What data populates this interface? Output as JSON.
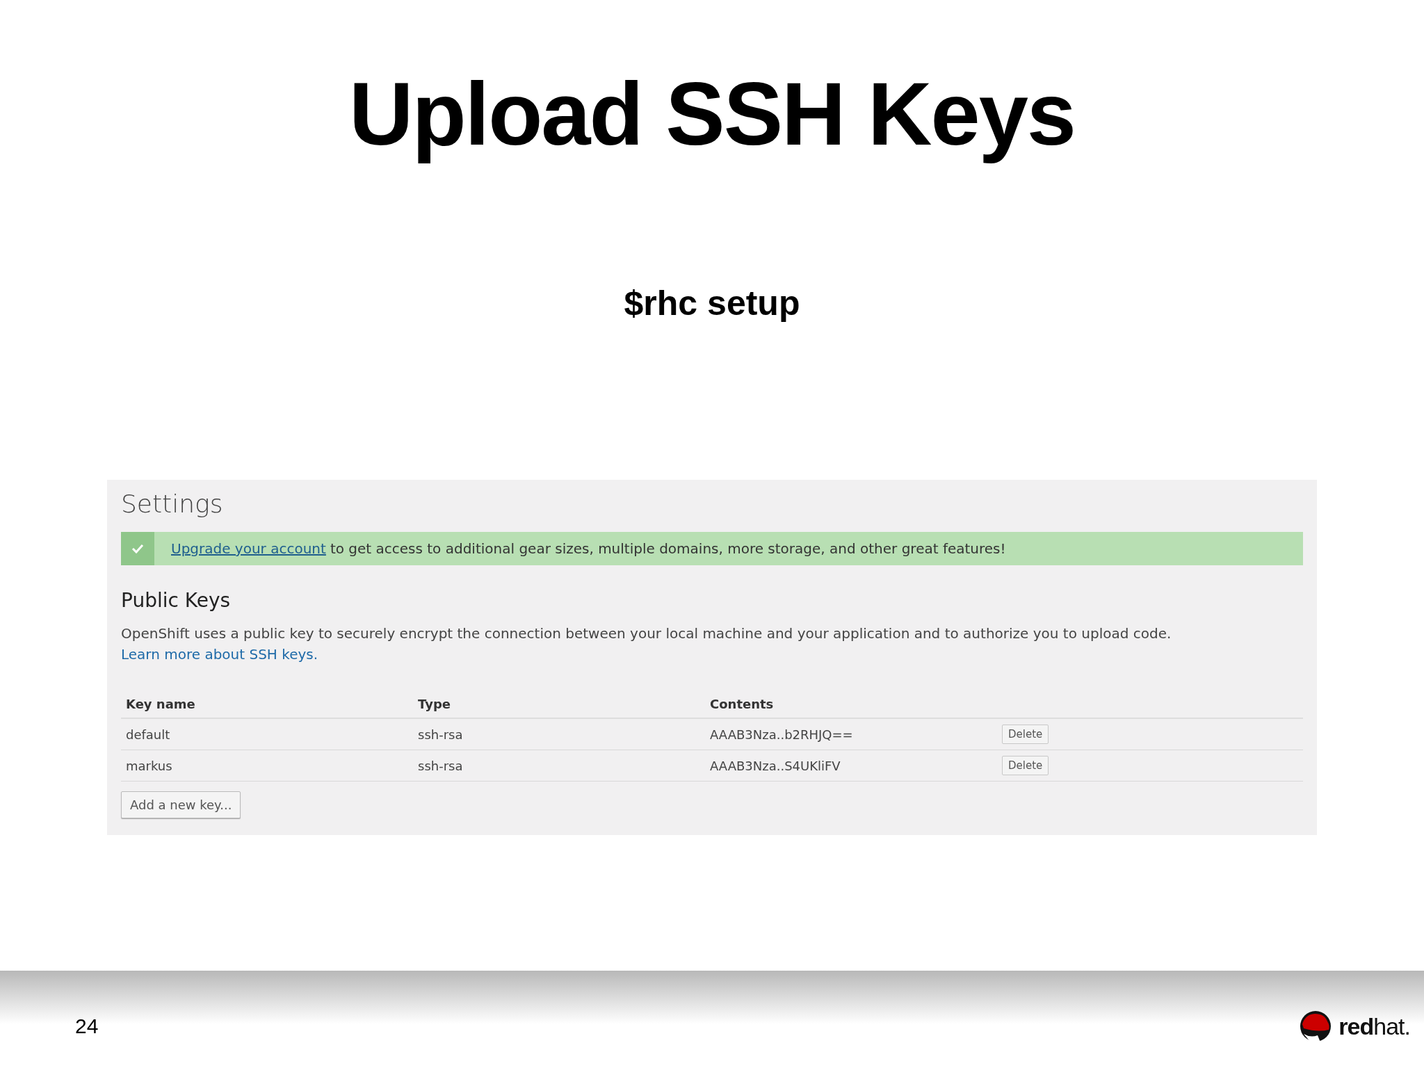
{
  "slide": {
    "title": "Upload SSH Keys",
    "subtitle": "$rhc setup",
    "page_number": "24",
    "logo_text": "**red**hat."
  },
  "settings": {
    "heading": "Settings",
    "notice": {
      "link": "Upgrade your account",
      "text": "to get access to additional gear sizes, multiple domains, more storage, and other great features!"
    },
    "section_title": "Public Keys",
    "description": {
      "text": "OpenShift uses a public key to securely encrypt the connection between your local machine and your application and to authorize you to upload code.",
      "link": "Learn more about SSH keys."
    },
    "table": {
      "columns": [
        "Key name",
        "Type",
        "Contents"
      ],
      "rows": [
        {
          "name": "default",
          "type": "ssh-rsa",
          "contents": "AAAB3Nza..b2RHJQ==",
          "action": "Delete"
        },
        {
          "name": "markus",
          "type": "ssh-rsa",
          "contents": "AAAB3Nza..S4UKliFV",
          "action": "Delete"
        }
      ]
    },
    "add_button": "Add a new key..."
  }
}
